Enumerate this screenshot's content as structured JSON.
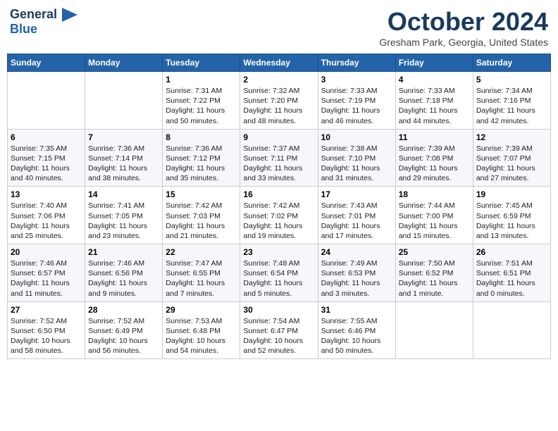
{
  "header": {
    "logo_line1": "General",
    "logo_line2": "Blue",
    "month_title": "October 2024",
    "location": "Gresham Park, Georgia, United States"
  },
  "days_of_week": [
    "Sunday",
    "Monday",
    "Tuesday",
    "Wednesday",
    "Thursday",
    "Friday",
    "Saturday"
  ],
  "weeks": [
    [
      {
        "day": "",
        "text": ""
      },
      {
        "day": "",
        "text": ""
      },
      {
        "day": "1",
        "text": "Sunrise: 7:31 AM\nSunset: 7:22 PM\nDaylight: 11 hours and 50 minutes."
      },
      {
        "day": "2",
        "text": "Sunrise: 7:32 AM\nSunset: 7:20 PM\nDaylight: 11 hours and 48 minutes."
      },
      {
        "day": "3",
        "text": "Sunrise: 7:33 AM\nSunset: 7:19 PM\nDaylight: 11 hours and 46 minutes."
      },
      {
        "day": "4",
        "text": "Sunrise: 7:33 AM\nSunset: 7:18 PM\nDaylight: 11 hours and 44 minutes."
      },
      {
        "day": "5",
        "text": "Sunrise: 7:34 AM\nSunset: 7:16 PM\nDaylight: 11 hours and 42 minutes."
      }
    ],
    [
      {
        "day": "6",
        "text": "Sunrise: 7:35 AM\nSunset: 7:15 PM\nDaylight: 11 hours and 40 minutes."
      },
      {
        "day": "7",
        "text": "Sunrise: 7:36 AM\nSunset: 7:14 PM\nDaylight: 11 hours and 38 minutes."
      },
      {
        "day": "8",
        "text": "Sunrise: 7:36 AM\nSunset: 7:12 PM\nDaylight: 11 hours and 35 minutes."
      },
      {
        "day": "9",
        "text": "Sunrise: 7:37 AM\nSunset: 7:11 PM\nDaylight: 11 hours and 33 minutes."
      },
      {
        "day": "10",
        "text": "Sunrise: 7:38 AM\nSunset: 7:10 PM\nDaylight: 11 hours and 31 minutes."
      },
      {
        "day": "11",
        "text": "Sunrise: 7:39 AM\nSunset: 7:08 PM\nDaylight: 11 hours and 29 minutes."
      },
      {
        "day": "12",
        "text": "Sunrise: 7:39 AM\nSunset: 7:07 PM\nDaylight: 11 hours and 27 minutes."
      }
    ],
    [
      {
        "day": "13",
        "text": "Sunrise: 7:40 AM\nSunset: 7:06 PM\nDaylight: 11 hours and 25 minutes."
      },
      {
        "day": "14",
        "text": "Sunrise: 7:41 AM\nSunset: 7:05 PM\nDaylight: 11 hours and 23 minutes."
      },
      {
        "day": "15",
        "text": "Sunrise: 7:42 AM\nSunset: 7:03 PM\nDaylight: 11 hours and 21 minutes."
      },
      {
        "day": "16",
        "text": "Sunrise: 7:42 AM\nSunset: 7:02 PM\nDaylight: 11 hours and 19 minutes."
      },
      {
        "day": "17",
        "text": "Sunrise: 7:43 AM\nSunset: 7:01 PM\nDaylight: 11 hours and 17 minutes."
      },
      {
        "day": "18",
        "text": "Sunrise: 7:44 AM\nSunset: 7:00 PM\nDaylight: 11 hours and 15 minutes."
      },
      {
        "day": "19",
        "text": "Sunrise: 7:45 AM\nSunset: 6:59 PM\nDaylight: 11 hours and 13 minutes."
      }
    ],
    [
      {
        "day": "20",
        "text": "Sunrise: 7:46 AM\nSunset: 6:57 PM\nDaylight: 11 hours and 11 minutes."
      },
      {
        "day": "21",
        "text": "Sunrise: 7:46 AM\nSunset: 6:56 PM\nDaylight: 11 hours and 9 minutes."
      },
      {
        "day": "22",
        "text": "Sunrise: 7:47 AM\nSunset: 6:55 PM\nDaylight: 11 hours and 7 minutes."
      },
      {
        "day": "23",
        "text": "Sunrise: 7:48 AM\nSunset: 6:54 PM\nDaylight: 11 hours and 5 minutes."
      },
      {
        "day": "24",
        "text": "Sunrise: 7:49 AM\nSunset: 6:53 PM\nDaylight: 11 hours and 3 minutes."
      },
      {
        "day": "25",
        "text": "Sunrise: 7:50 AM\nSunset: 6:52 PM\nDaylight: 11 hours and 1 minute."
      },
      {
        "day": "26",
        "text": "Sunrise: 7:51 AM\nSunset: 6:51 PM\nDaylight: 11 hours and 0 minutes."
      }
    ],
    [
      {
        "day": "27",
        "text": "Sunrise: 7:52 AM\nSunset: 6:50 PM\nDaylight: 10 hours and 58 minutes."
      },
      {
        "day": "28",
        "text": "Sunrise: 7:52 AM\nSunset: 6:49 PM\nDaylight: 10 hours and 56 minutes."
      },
      {
        "day": "29",
        "text": "Sunrise: 7:53 AM\nSunset: 6:48 PM\nDaylight: 10 hours and 54 minutes."
      },
      {
        "day": "30",
        "text": "Sunrise: 7:54 AM\nSunset: 6:47 PM\nDaylight: 10 hours and 52 minutes."
      },
      {
        "day": "31",
        "text": "Sunrise: 7:55 AM\nSunset: 6:46 PM\nDaylight: 10 hours and 50 minutes."
      },
      {
        "day": "",
        "text": ""
      },
      {
        "day": "",
        "text": ""
      }
    ]
  ]
}
